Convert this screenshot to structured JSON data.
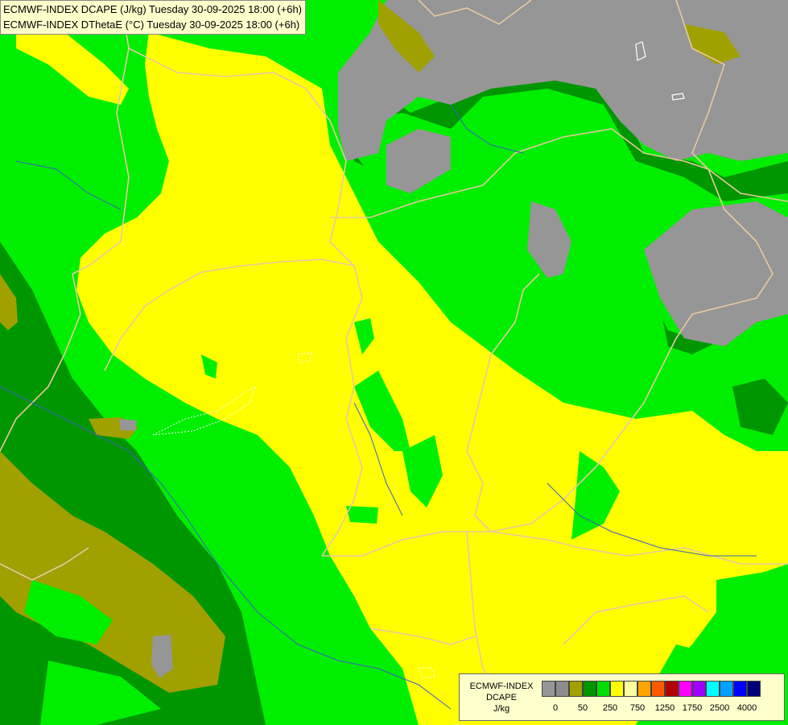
{
  "title": {
    "line1": "ECMWF-INDEX DCAPE (J/kg) Tuesday 30-09-2025 18:00 (+6h)",
    "line2": "ECMWF-INDEX DThetaE (°C) Tuesday 30-09-2025 18:00 (+6h)"
  },
  "legend": {
    "model": "ECMWF-INDEX",
    "parameter": "DCAPE",
    "unit": "J/kg",
    "colors": [
      "#969696",
      "#8c8c8c",
      "#a0a000",
      "#009600",
      "#00e000",
      "#ffff00",
      "#ffffa0",
      "#ffa500",
      "#ff5a00",
      "#b40000",
      "#ff00ff",
      "#a000ff",
      "#00ffff",
      "#00a0ff",
      "#0000ff",
      "#00007a"
    ],
    "tick_labels": [
      "0",
      "50",
      "250",
      "750",
      "1250",
      "1750",
      "2500",
      "4000"
    ]
  },
  "map_colors": {
    "grey": "#969696",
    "olive": "#a0a000",
    "dark_green": "#009600",
    "green": "#00e000",
    "yellow": "#ffff00",
    "border": "#e8c8a0",
    "river": "#4060c0"
  }
}
